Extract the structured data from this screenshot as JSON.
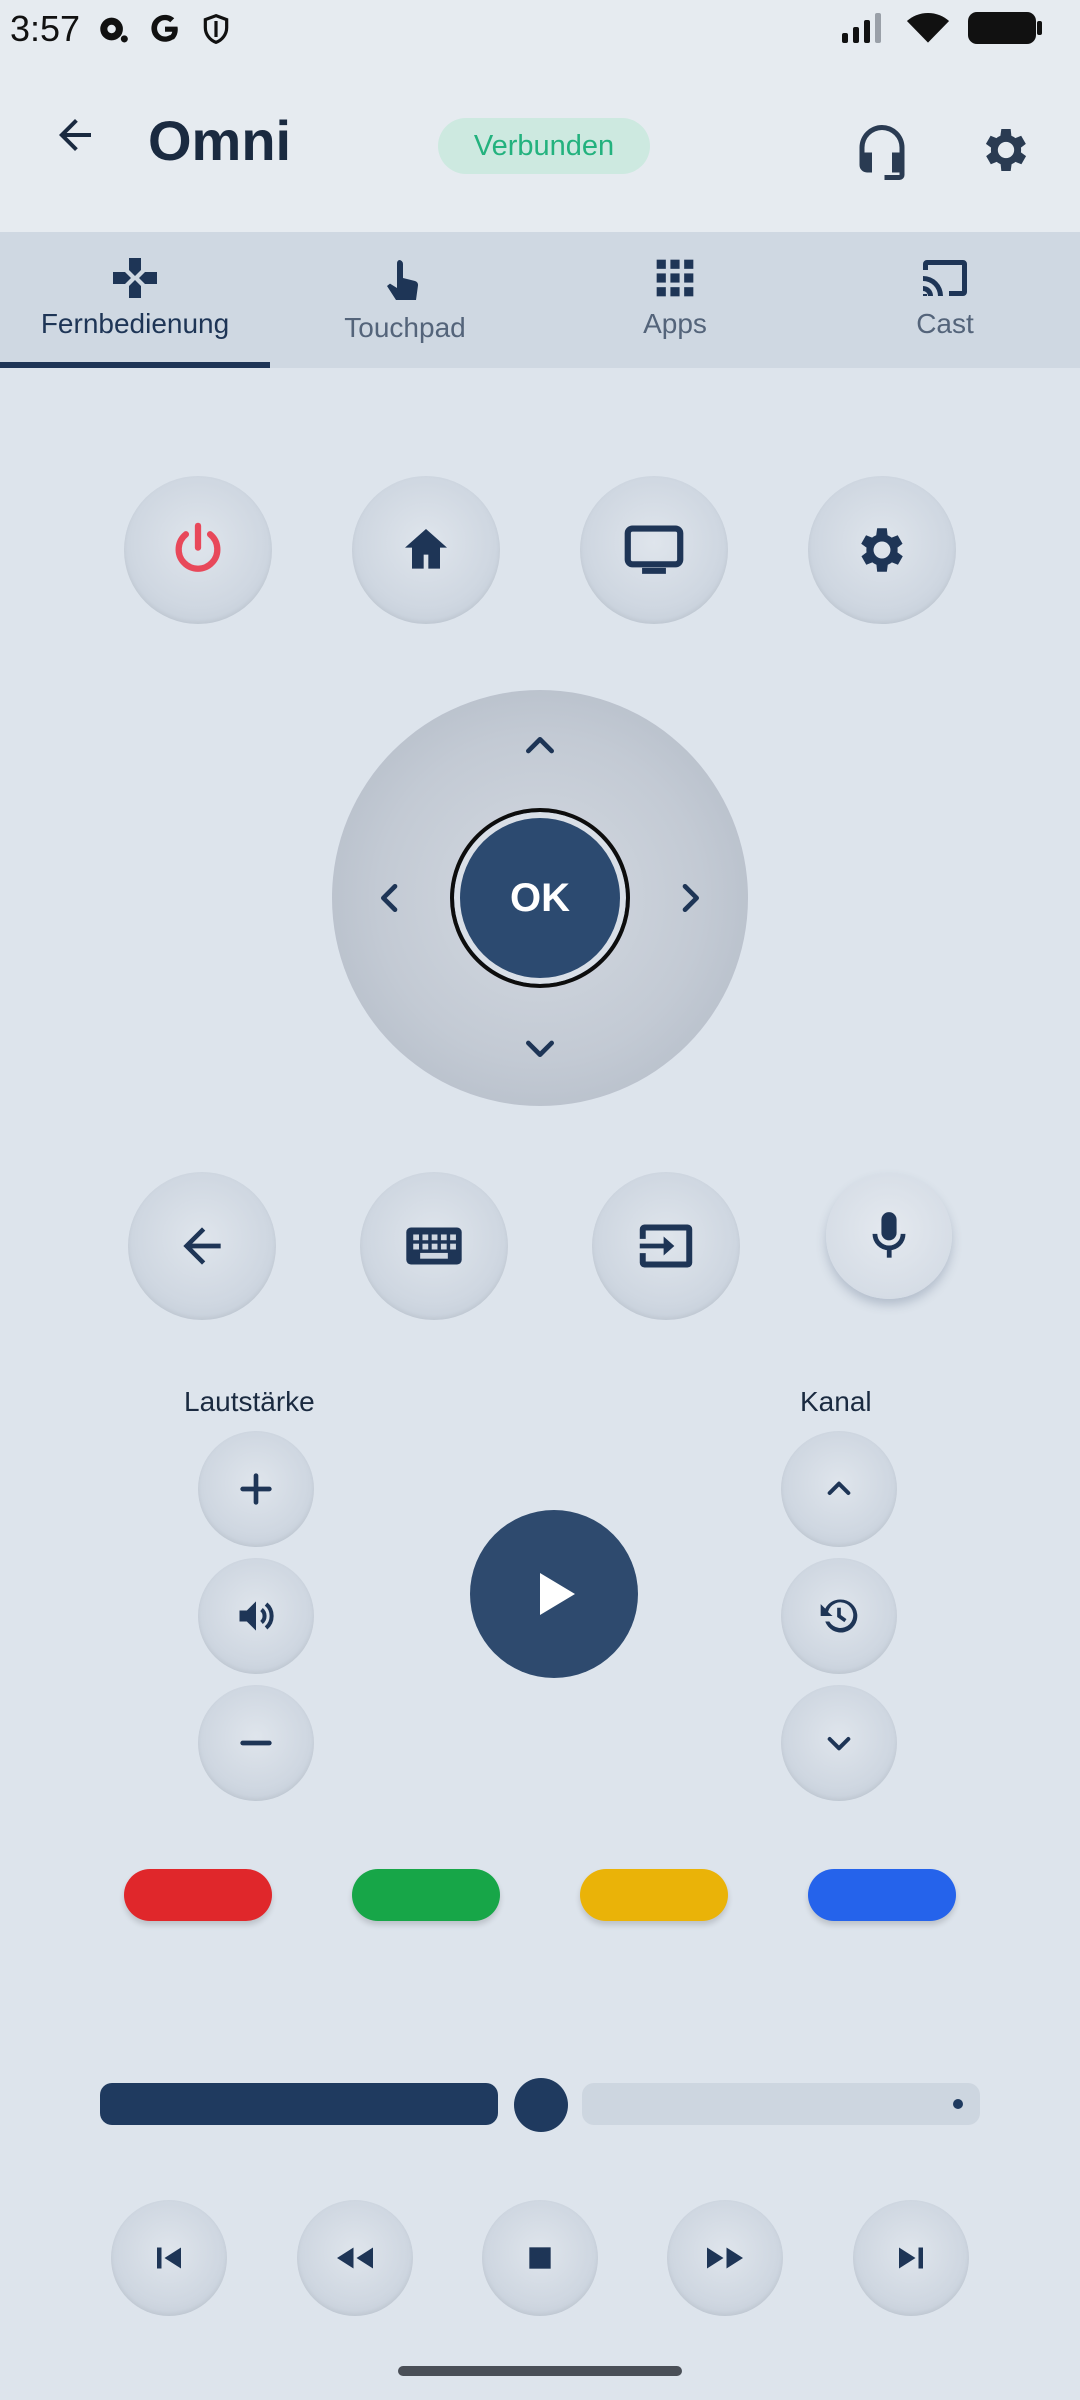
{
  "status_bar": {
    "time": "3:57"
  },
  "app_bar": {
    "title": "Omni",
    "connection_status": "Verbunden"
  },
  "tabs": [
    {
      "label": "Fernbedienung",
      "icon": "gamepad-icon",
      "active": true
    },
    {
      "label": "Touchpad",
      "icon": "touch-icon",
      "active": false
    },
    {
      "label": "Apps",
      "icon": "apps-grid-icon",
      "active": false
    },
    {
      "label": "Cast",
      "icon": "cast-icon",
      "active": false
    }
  ],
  "dpad": {
    "ok_label": "OK"
  },
  "volume": {
    "label": "Lautstärke"
  },
  "channel": {
    "label": "Kanal"
  },
  "color_keys": {
    "red": "#e0272b",
    "green": "#17a648",
    "yellow": "#eab308",
    "blue": "#2563eb"
  },
  "colors": {
    "accent": "#1f3a5f",
    "power": "#e8485a",
    "connected": "#23b27e"
  },
  "playback": {
    "progress_fraction": 0.5
  }
}
